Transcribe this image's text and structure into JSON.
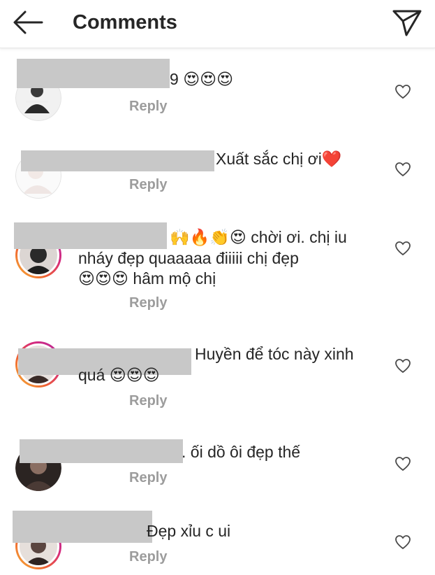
{
  "header": {
    "title": "Comments",
    "back_icon": "arrow-left-icon",
    "send_icon": "paper-plane-icon"
  },
  "comments": [
    {
      "visible_name_fragment": "9",
      "text_line1": "",
      "emoji_line1": "😍😍😍",
      "text_line2": "",
      "text_line3": "",
      "reply_label": "Reply"
    },
    {
      "visible_name_fragment": "",
      "text_line1": "Xuất sắc chị ơi",
      "emoji_line1": "❤️",
      "text_line2": "",
      "text_line3": "",
      "reply_label": "Reply"
    },
    {
      "visible_name_fragment": "",
      "text_line1": "chời ơi. chị iu",
      "emoji_line1": "🙌🔥👏😍",
      "text_line2": "nháy đẹp quaaaaa điiiii chị đẹp",
      "text_line3": "hâm mộ chị",
      "emoji_line3": "😍😍😍",
      "reply_label": "Reply"
    },
    {
      "visible_name_fragment": "",
      "text_line1": "Huyền để tóc này xinh",
      "text_line2": "quá",
      "emoji_line2": "😍😍😍",
      "reply_label": "Reply"
    },
    {
      "visible_name_fragment": "",
      "text_line1": ". ối dồ ôi đẹp thế",
      "reply_label": "Reply"
    },
    {
      "visible_name_fragment": "",
      "text_line1": "Đẹp xỉu c ui",
      "reply_label": "Reply"
    }
  ],
  "colors": {
    "text": "#262626",
    "reply": "#9c9c9c",
    "redaction": "#c8c8c8",
    "story_ring": "#d62a7d"
  }
}
